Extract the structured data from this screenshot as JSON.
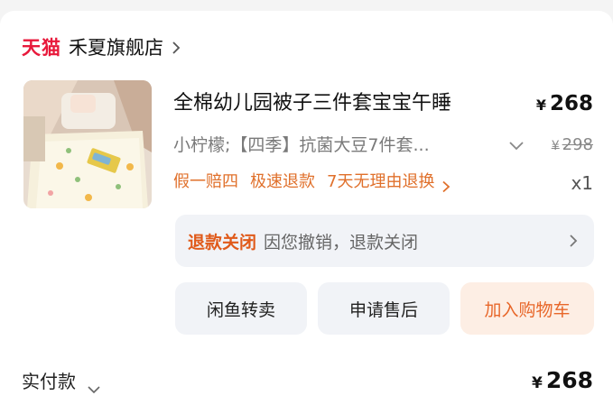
{
  "store": {
    "platform_logo": "天猫",
    "name": "禾夏旗舰店"
  },
  "product": {
    "title": "全棉幼儿园被子三件套宝宝午睡",
    "price_symbol": "¥",
    "price": "268",
    "sku": "小柠檬;【四季】抗菌大豆7件套...",
    "original_price": "298",
    "tags": [
      "假一赔四",
      "极速退款",
      "7天无理由退换"
    ],
    "quantity": "x1"
  },
  "refund": {
    "status": "退款关闭",
    "description": "因您撤销，退款关闭"
  },
  "buttons": {
    "xianyu": "闲鱼转卖",
    "after_sale": "申请售后",
    "add_to_cart": "加入购物车"
  },
  "footer": {
    "label": "实付款",
    "amount": "268"
  },
  "colors": {
    "tmall_red": "#e8193b",
    "accent_orange": "#e0702b",
    "refund_red": "#e05a1a"
  },
  "icons": [
    "chevron-right-icon",
    "chevron-down-icon"
  ]
}
